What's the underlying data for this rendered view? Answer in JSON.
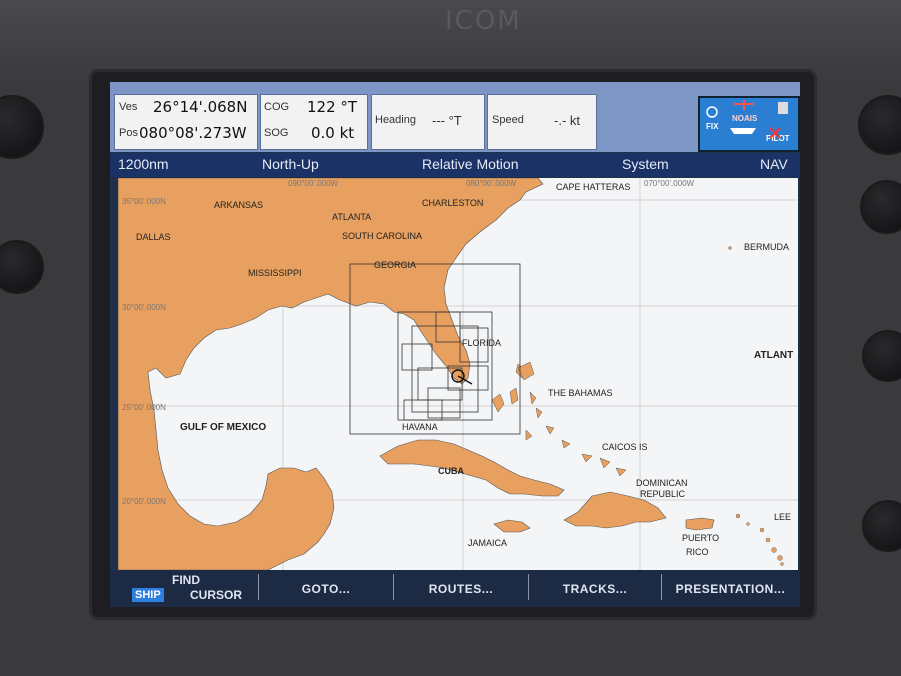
{
  "brand": "ICOM",
  "top_panel": {
    "vessel_label": "Ves",
    "lat": "26°14'.068N",
    "pos_label": "Pos",
    "lon": "080°08'.273W",
    "cog_label": "COG",
    "cog_value": "122 °T",
    "sog_label": "SOG",
    "sog_value": "0.0 kt",
    "heading_label": "Heading",
    "heading_value": "--- °T",
    "speed_label": "Speed",
    "speed_value": "-.- kt",
    "icons": {
      "fix": "FIX",
      "noais": "NOAIS",
      "pilot": "PILOT"
    }
  },
  "status_bar": {
    "range": "1200nm",
    "orientation": "North-Up",
    "motion": "Relative Motion",
    "system": "System",
    "mode": "NAV"
  },
  "map": {
    "places": {
      "arkansas": "ARKANSAS",
      "atlanta": "ATLANTA",
      "charleston": "CHARLESTON",
      "cape_hatteras": "CAPE HATTERAS",
      "dallas": "DALLAS",
      "south_carolina": "SOUTH CAROLINA",
      "bermuda": "BERMUDA",
      "mississippi": "MISSISSIPPI",
      "georgia": "GEORGIA",
      "florida": "FLORIDA",
      "atlantic": "ATLANT",
      "the_bahamas": "THE BAHAMAS",
      "gulf_of_mexico": "GULF OF MEXICO",
      "havana": "HAVANA",
      "caicos": "CAICOS IS",
      "cuba": "CUBA",
      "dominican_1": "DOMINICAN",
      "dominican_2": "REPUBLIC",
      "jamaica": "JAMAICA",
      "puerto_1": "PUERTO",
      "puerto_2": "RICO",
      "lee": "LEE"
    },
    "coords": {
      "lon_090": "090°00'.000W",
      "lon_080": "080°00'.000W",
      "lon_070": "070°00'.000W",
      "lat_35": "35°00'.000N",
      "lat_30": "30°00'.000N",
      "lat_25": "25°00'.000N",
      "lat_20": "20°00'.000N"
    },
    "colors": {
      "land": "#e8a060",
      "sea": "#f4f5f7",
      "grid": "#c9c9c9"
    }
  },
  "softkeys": {
    "ship": "SHIP",
    "find": "FIND",
    "cursor": "CURSOR",
    "goto": "GOTO...",
    "routes": "ROUTES...",
    "tracks": "TRACKS...",
    "presentation": "PRESENTATION..."
  }
}
